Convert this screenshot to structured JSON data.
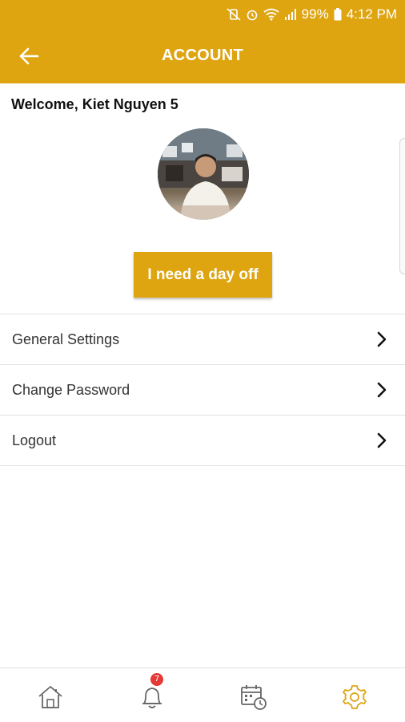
{
  "status_bar": {
    "battery": "99%",
    "time": "4:12 PM",
    "icons": [
      "mute-vibrate-icon",
      "alarm-icon",
      "wifi-icon",
      "signal-icon",
      "battery-icon"
    ]
  },
  "toolbar": {
    "title": "ACCOUNT",
    "back_icon": "arrow-left-icon"
  },
  "profile": {
    "welcome": "Welcome, Kiet Nguyen 5",
    "avatar": "profile-photo"
  },
  "actions": {
    "day_off_label": "I need a day off"
  },
  "menu": {
    "items": [
      {
        "label": "General Settings",
        "icon": "chevron-right-icon"
      },
      {
        "label": "Change Password",
        "icon": "chevron-right-icon"
      },
      {
        "label": "Logout",
        "icon": "chevron-right-icon"
      }
    ]
  },
  "bottom_nav": {
    "items": [
      {
        "name": "home",
        "icon": "home-icon",
        "active": false
      },
      {
        "name": "notifications",
        "icon": "bell-icon",
        "badge": "7",
        "active": false
      },
      {
        "name": "schedule",
        "icon": "calendar-clock-icon",
        "active": false
      },
      {
        "name": "settings",
        "icon": "gear-icon",
        "active": true
      }
    ]
  },
  "colors": {
    "accent": "#DEA511",
    "badge": "#E53935",
    "icon_inactive": "#666666"
  }
}
